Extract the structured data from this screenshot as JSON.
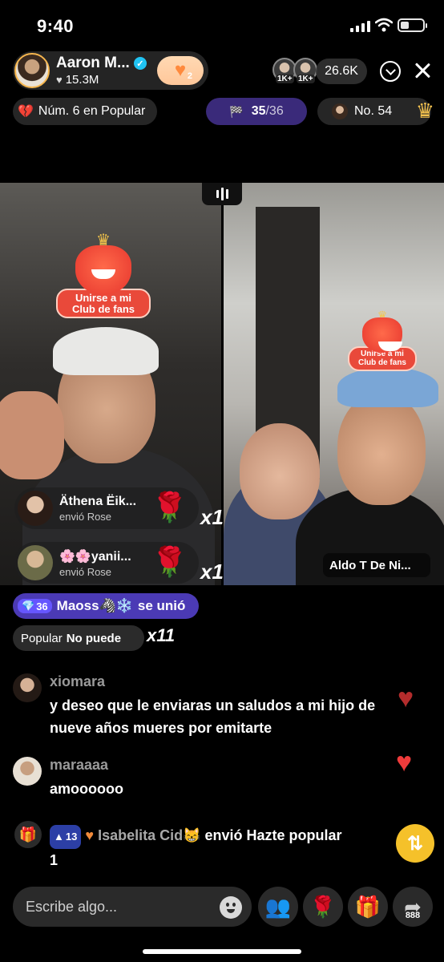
{
  "status_bar": {
    "time": "9:40"
  },
  "host": {
    "name": "Aaron M...",
    "likes": "15.3M",
    "follow_count": "2"
  },
  "viewers": {
    "badge_1": "1K+",
    "badge_2": "1K+",
    "count": "26.6K"
  },
  "ranking": {
    "popular_label": "Núm. 6 en Popular",
    "progress_current": "35",
    "progress_total": "/36",
    "rank_label": "No. 54"
  },
  "stickers": {
    "left_text": "Unirse a mi Club de fans",
    "right_text": "Unirse a mi Club de fans"
  },
  "opponent": {
    "name": "Aldo T De Ni..."
  },
  "gifts": [
    {
      "sender": "Äthena Ëik...",
      "action": "envió Rose",
      "multiplier": "x1"
    },
    {
      "sender": "🌸🌸yanii...",
      "action": "envió Rose",
      "multiplier": "x1"
    }
  ],
  "join": {
    "level": "36",
    "user": "Maoss🦓❄️",
    "text": "se unió"
  },
  "popular_notice": {
    "label": "Popular",
    "text": "No puede",
    "multiplier": "x11"
  },
  "comments": [
    {
      "user": "xiomara",
      "text": "y deseo que le enviaras un saludos a mi hijo de nueve años mueres por emitarte"
    },
    {
      "user": "maraaaa",
      "text": "amoooooo"
    }
  ],
  "system_message": {
    "level": "13",
    "user": "Isabelita Cid😸",
    "text": "envió Hazte popular",
    "count": "1"
  },
  "bottom_bar": {
    "input_placeholder": "Escribe algo...",
    "share_count": "888"
  },
  "colors": {
    "accent_purple": "#4b3ab5",
    "heart_red": "#ef3b3b",
    "follow_orange": "#ff8a3d"
  }
}
